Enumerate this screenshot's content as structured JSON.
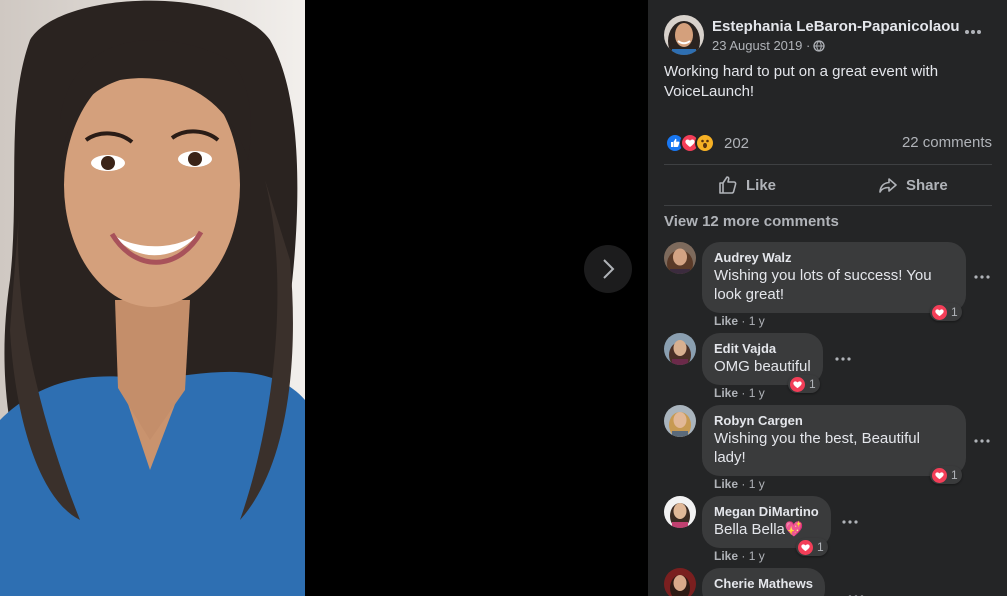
{
  "viewer": {
    "next_icon": "chevron-right-icon"
  },
  "post": {
    "author": "Estephania LeBaron-Papanicolaou",
    "date": "23 August 2019 ·",
    "audience_icon": "globe-icon",
    "text": "Working hard to put on a great event with VoiceLaunch!",
    "more_icon": "more-horizontal-icon",
    "reaction_count": "202",
    "comment_count": "22 comments",
    "reactions": [
      "like-reaction-icon",
      "love-reaction-icon",
      "wow-reaction-icon"
    ]
  },
  "actions": {
    "like_label": "Like",
    "share_label": "Share"
  },
  "comments_section": {
    "view_more": "View 12 more comments",
    "items": [
      {
        "name": "Audrey Walz",
        "text": "Wishing you lots of success! You look great!",
        "like": "Like",
        "time": "· 1 y",
        "react_count": "1"
      },
      {
        "name": "Edit Vajda",
        "text": "OMG beautiful",
        "like": "Like",
        "time": "· 1 y",
        "react_count": "1"
      },
      {
        "name": "Robyn Cargen",
        "text": "Wishing you the best, Beautiful lady!",
        "like": "Like",
        "time": "· 1 y",
        "react_count": "1"
      },
      {
        "name": "Megan DiMartino",
        "text": "Bella Bella💖",
        "like": "Like",
        "time": "· 1 y",
        "react_count": "1"
      },
      {
        "name": "Cherie Mathews",
        "text": "",
        "like": "",
        "time": "",
        "react_count": ""
      }
    ]
  },
  "colors": {
    "panel_bg": "#242526",
    "bubble_bg": "#3a3b3c",
    "text_primary": "#e4e6eb",
    "text_secondary": "#b0b3b8",
    "like_blue": "#1877f2",
    "love_red": "#f33e58",
    "wow_yellow": "#f7b125"
  }
}
